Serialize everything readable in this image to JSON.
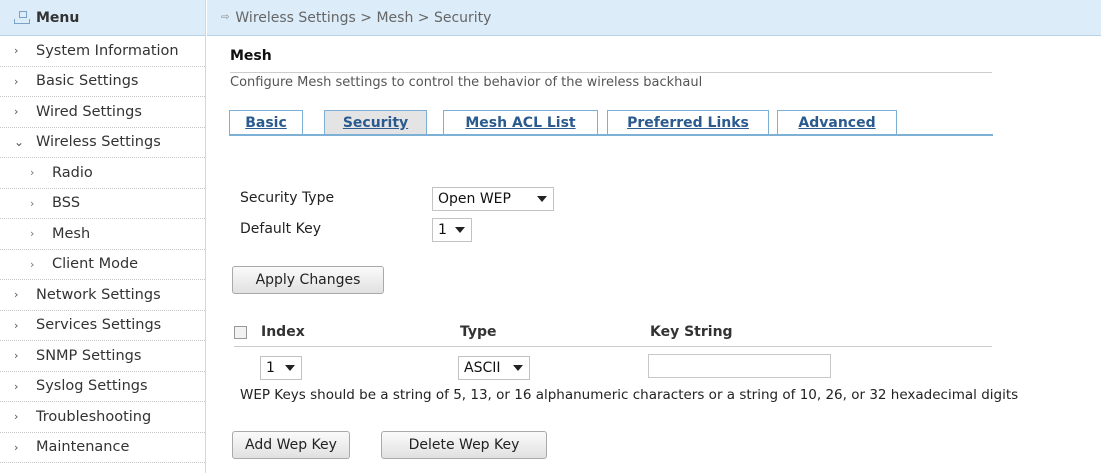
{
  "menu": {
    "title": "Menu",
    "items": [
      {
        "label": "System Information",
        "arrow": "›",
        "level": 0
      },
      {
        "label": "Basic Settings",
        "arrow": "›",
        "level": 0
      },
      {
        "label": "Wired Settings",
        "arrow": "›",
        "level": 0
      },
      {
        "label": "Wireless Settings",
        "arrow": "⌄",
        "level": 0
      },
      {
        "label": "Radio",
        "arrow": "›",
        "level": 1
      },
      {
        "label": "BSS",
        "arrow": "›",
        "level": 1
      },
      {
        "label": "Mesh",
        "arrow": "›",
        "level": 1
      },
      {
        "label": "Client Mode",
        "arrow": "›",
        "level": 1
      },
      {
        "label": "Network Settings",
        "arrow": "›",
        "level": 0
      },
      {
        "label": "Services Settings",
        "arrow": "›",
        "level": 0
      },
      {
        "label": "SNMP Settings",
        "arrow": "›",
        "level": 0
      },
      {
        "label": "Syslog Settings",
        "arrow": "›",
        "level": 0
      },
      {
        "label": "Troubleshooting",
        "arrow": "›",
        "level": 0
      },
      {
        "label": "Maintenance",
        "arrow": "›",
        "level": 0
      }
    ]
  },
  "breadcrumb": "Wireless Settings > Mesh > Security",
  "page": {
    "title": "Mesh",
    "description": "Configure Mesh settings to control the behavior of the wireless backhaul"
  },
  "tabs": [
    "Basic",
    "Security",
    "Mesh ACL List",
    "Preferred Links",
    "Advanced"
  ],
  "form": {
    "security_type_label": "Security Type",
    "security_type_value": "Open WEP",
    "default_key_label": "Default Key",
    "default_key_value": "1",
    "apply_button": "Apply Changes"
  },
  "key_table": {
    "headers": {
      "index": "Index",
      "type": "Type",
      "key_string": "Key String"
    },
    "row": {
      "index": "1",
      "type": "ASCII",
      "key_string": ""
    }
  },
  "hint": "WEP Keys should be a string of 5, 13, or 16 alphanumeric characters or a string of 10, 26, or 32 hexadecimal digits",
  "buttons": {
    "add": "Add Wep Key",
    "delete": "Delete Wep Key"
  }
}
